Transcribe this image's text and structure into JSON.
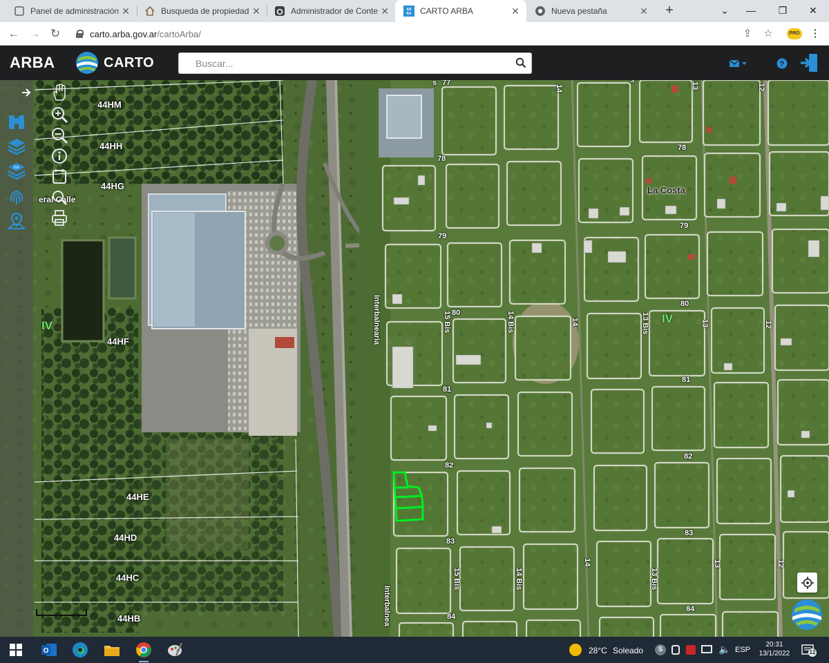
{
  "browser": {
    "tabs": [
      {
        "title": "Panel de administración",
        "icon": "page-icon",
        "active": false
      },
      {
        "title": "Busqueda de propiedades",
        "icon": "home-icon",
        "active": false
      },
      {
        "title": "Administrador de Contenidos",
        "icon": "cms-icon",
        "active": false
      },
      {
        "title": "CARTO ARBA",
        "icon": "arba-favicon",
        "active": true
      },
      {
        "title": "Nueva pestaña",
        "icon": "chrome-icon",
        "active": false
      }
    ],
    "new_tab_label": "+",
    "url_host": "carto.arba.gov.ar",
    "url_path": "/cartoArba/"
  },
  "app": {
    "brand": "ARBA",
    "product": "CARTO",
    "search_placeholder": "Buscar...",
    "colors": {
      "header": "#1d1f21",
      "accent": "#2a8fd4",
      "parcel_highlight": "#00ee22"
    }
  },
  "map": {
    "zone_labels": [
      "44HM",
      "44HH",
      "44HG",
      "44HF",
      "44HE",
      "44HD",
      "44HC",
      "44HB"
    ],
    "roman_labels": [
      "IV",
      "IV"
    ],
    "street_labels": {
      "s77": "77",
      "s78": "78",
      "s79a": "79",
      "s79b": "79",
      "s80a": "80",
      "s80b": "80",
      "s81a": "81",
      "s81b": "81",
      "s82a": "82",
      "s82b": "82",
      "s83a": "83",
      "s83b": "83",
      "s84a": "84",
      "s84b": "84",
      "s14a": "14",
      "s14b": "14",
      "s14c": "14",
      "s13a": "13",
      "s13b": "13",
      "s13c": "13",
      "s12a": "12",
      "s12b": "12",
      "s12c": "12",
      "s15bisA": "15 Bis",
      "s15bisB": "15 Bis",
      "s14bisA": "14 Bis",
      "s14bisB": "14 Bis",
      "s13bisA": "13 Bis",
      "s13bisB": "13 Bis",
      "interA": "Interbalnearia",
      "interB": "Interbalnea",
      "calle": "eral Calle",
      "sA": "s",
      "sB": "s"
    },
    "place": "La Costa"
  },
  "taskbar": {
    "weather_temp": "28°C",
    "weather_text": "Soleado",
    "language": "ESP",
    "time": "20:31",
    "date": "13/1/2022",
    "notifications": "12"
  }
}
